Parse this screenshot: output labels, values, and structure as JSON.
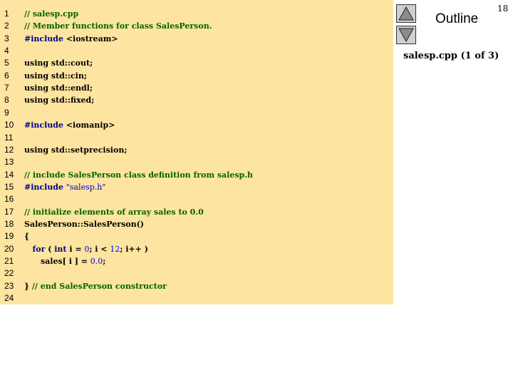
{
  "slide_number": "18",
  "outline": {
    "title": "Outline",
    "subtitle": "salesp.cpp (1 of 3)",
    "prev_icon": "triangle-up-icon",
    "next_icon": "triangle-down-icon"
  },
  "colors": {
    "panel_bg": "#fde4a0",
    "comment": "#006400",
    "preprocessor": "#00008b",
    "string": "#0000cd",
    "keyword": "#000080",
    "number": "#0000ff"
  },
  "code": {
    "lines": [
      {
        "n": "1",
        "segs": [
          [
            "cm",
            "// salesp.cpp"
          ]
        ]
      },
      {
        "n": "2",
        "segs": [
          [
            "cm",
            "// Member functions for class SalesPerson."
          ]
        ]
      },
      {
        "n": "3",
        "segs": [
          [
            "pp",
            "#include "
          ],
          [
            "tx",
            "<iostream>"
          ]
        ]
      },
      {
        "n": "4",
        "segs": []
      },
      {
        "n": "5",
        "segs": [
          [
            "tx",
            "using std::cout;"
          ]
        ]
      },
      {
        "n": "6",
        "segs": [
          [
            "tx",
            "using std::cin;"
          ]
        ]
      },
      {
        "n": "7",
        "segs": [
          [
            "tx",
            "using std::endl;"
          ]
        ]
      },
      {
        "n": "8",
        "segs": [
          [
            "tx",
            "using std::fixed;"
          ]
        ]
      },
      {
        "n": "9",
        "segs": []
      },
      {
        "n": "10",
        "segs": [
          [
            "pp",
            "#include "
          ],
          [
            "tx",
            "<iomanip>"
          ]
        ]
      },
      {
        "n": "11",
        "segs": []
      },
      {
        "n": "12",
        "segs": [
          [
            "tx",
            "using std::setprecision;"
          ]
        ]
      },
      {
        "n": "13",
        "segs": []
      },
      {
        "n": "14",
        "segs": [
          [
            "cm",
            "// include SalesPerson class definition from salesp.h"
          ]
        ]
      },
      {
        "n": "15",
        "segs": [
          [
            "pp",
            "#include "
          ],
          [
            "st",
            "\"salesp.h\""
          ]
        ]
      },
      {
        "n": "16",
        "segs": []
      },
      {
        "n": "17",
        "segs": [
          [
            "cm",
            "// initialize elements of array sales to 0.0"
          ]
        ]
      },
      {
        "n": "18",
        "segs": [
          [
            "tx",
            "SalesPerson::SalesPerson()"
          ]
        ]
      },
      {
        "n": "19",
        "segs": [
          [
            "tx",
            "{"
          ]
        ]
      },
      {
        "n": "20",
        "segs": [
          [
            "tx",
            "   "
          ],
          [
            "kw",
            "for"
          ],
          [
            "tx",
            " ( "
          ],
          [
            "kw",
            "int"
          ],
          [
            "tx",
            " i = "
          ],
          [
            "nm",
            "0"
          ],
          [
            "tx",
            "; i < "
          ],
          [
            "nm",
            "12"
          ],
          [
            "tx",
            "; i++ )"
          ]
        ]
      },
      {
        "n": "21",
        "segs": [
          [
            "tx",
            "      sales[ i ] = "
          ],
          [
            "nm",
            "0.0"
          ],
          [
            "tx",
            ";"
          ]
        ]
      },
      {
        "n": "22",
        "segs": []
      },
      {
        "n": "23",
        "segs": [
          [
            "tx",
            "} "
          ],
          [
            "cm",
            "// end SalesPerson constructor"
          ]
        ]
      },
      {
        "n": "24",
        "segs": []
      }
    ]
  }
}
